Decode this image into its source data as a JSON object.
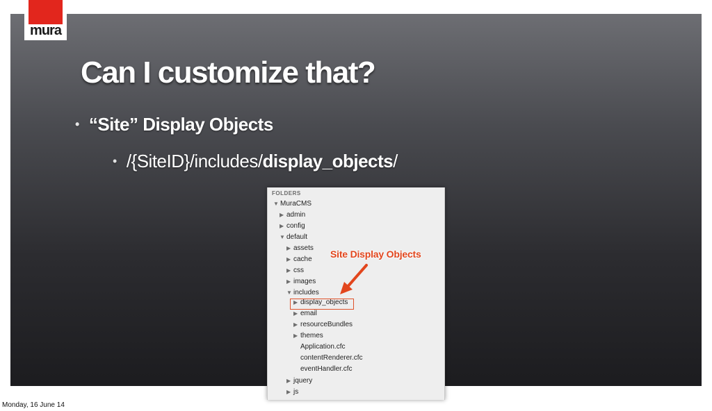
{
  "logo": {
    "text": "mura",
    "brand_color": "#e2261d"
  },
  "slide": {
    "title": "Can I customize that?",
    "bullet1": "“Site” Display Objects",
    "bullet2_prefix": "/{SiteID}/includes/",
    "bullet2_bold": "display_objects",
    "bullet2_suffix": "/"
  },
  "panel": {
    "header": "FOLDERS",
    "tree": [
      {
        "label": "MuraCMS",
        "expanded": true
      },
      {
        "label": "admin",
        "expanded": false
      },
      {
        "label": "config",
        "expanded": false
      },
      {
        "label": "default",
        "expanded": true
      },
      {
        "label": "assets",
        "expanded": false
      },
      {
        "label": "cache",
        "expanded": false
      },
      {
        "label": "css",
        "expanded": false
      },
      {
        "label": "images",
        "expanded": false
      },
      {
        "label": "includes",
        "expanded": true
      },
      {
        "label": "display_objects",
        "expanded": false
      },
      {
        "label": "email",
        "expanded": false
      },
      {
        "label": "resourceBundles",
        "expanded": false
      },
      {
        "label": "themes",
        "expanded": false
      },
      {
        "label": "Application.cfc",
        "file": true
      },
      {
        "label": "contentRenderer.cfc",
        "file": true
      },
      {
        "label": "eventHandler.cfc",
        "file": true
      },
      {
        "label": "jquery",
        "expanded": false
      },
      {
        "label": "js",
        "expanded": false
      }
    ],
    "callout": "Site Display Objects",
    "callout_color": "#e2461d"
  },
  "footer": {
    "date": "Monday, 16 June 14"
  }
}
